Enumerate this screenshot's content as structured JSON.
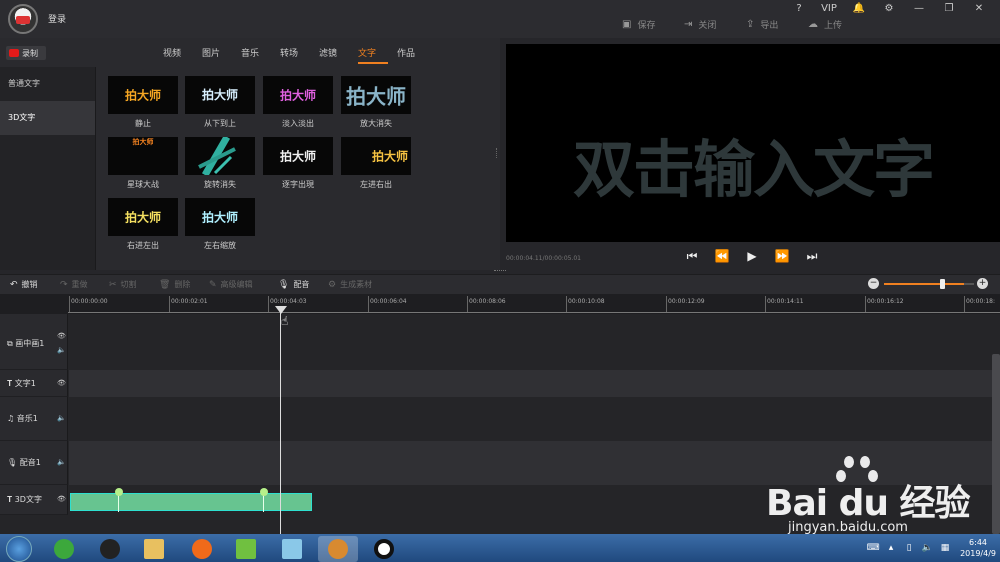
{
  "title_bar": {
    "login": "登录",
    "window_buttons": [
      "?",
      "VIP",
      "🔔",
      "⚙",
      "—",
      "❐",
      "✕"
    ],
    "actions": [
      {
        "label": "保存",
        "icon": "save-icon"
      },
      {
        "label": "关闭",
        "icon": "exit-icon"
      },
      {
        "label": "导出",
        "icon": "export-icon"
      },
      {
        "label": "上传",
        "icon": "upload-icon"
      }
    ]
  },
  "media_panel": {
    "record_label": "录制",
    "tabs": [
      "视频",
      "图片",
      "音乐",
      "转场",
      "滤镜",
      "文字",
      "作品"
    ],
    "active_tab": "文字",
    "sidebar": [
      "普通文字",
      "3D文字"
    ],
    "active_sidebar": "3D文字",
    "thumbnails": [
      {
        "text": "拍大师",
        "caption": "静止",
        "color": "#f5a623"
      },
      {
        "text": "拍大师",
        "caption": "从下到上",
        "color": "#d8f0ff"
      },
      {
        "text": "拍大师",
        "caption": "淡入淡出",
        "color": "#e060e0"
      },
      {
        "text": "拍大师",
        "caption": "放大消失",
        "color": "#8ab4c8"
      },
      {
        "text": "拍大师",
        "caption": "星球大战",
        "color": "#f08020"
      },
      {
        "text": "",
        "caption": "旋转消失",
        "color": "#30b0a0"
      },
      {
        "text": "拍大师",
        "caption": "逐字出現",
        "color": "#f0f0f0"
      },
      {
        "text": "拍大师",
        "caption": "左进右出",
        "color": "#f5c242"
      },
      {
        "text": "拍大师",
        "caption": "右进左出",
        "color": "#f5e060"
      },
      {
        "text": "拍大师",
        "caption": "左右缩放",
        "color": "#b0f0ff"
      }
    ]
  },
  "preview": {
    "text": "双击输入文字",
    "timecode": "00:00:04.11/00:00:05.01",
    "controls": [
      "⏮",
      "⏪",
      "▶",
      "⏩",
      "⏭"
    ]
  },
  "toolbar": {
    "buttons": [
      {
        "label": "撤销",
        "icon": "undo-icon",
        "enabled": true
      },
      {
        "label": "重做",
        "icon": "redo-icon",
        "enabled": false
      },
      {
        "label": "切割",
        "icon": "scissors-icon",
        "enabled": false
      },
      {
        "label": "删除",
        "icon": "trash-icon",
        "enabled": false
      },
      {
        "label": "高级编辑",
        "icon": "pen-icon",
        "enabled": false
      },
      {
        "label": "配音",
        "icon": "microphone-icon",
        "enabled": true
      },
      {
        "label": "生成素材",
        "icon": "gear-icon",
        "enabled": false
      }
    ],
    "zoom": {
      "minus": "−",
      "plus": "+",
      "level": 0.7
    }
  },
  "ruler_ticks": [
    "00:00:00:00",
    "00:00:02:01",
    "00:00:04:03",
    "00:00:06:04",
    "00:00:08:06",
    "00:00:10:08",
    "00:00:12:09",
    "00:00:14:11",
    "00:00:16:12",
    "00:00:18:"
  ],
  "tracks": [
    {
      "label": "画中画1",
      "icon": "pip-icon"
    },
    {
      "label": "文字1",
      "icon": "text-icon"
    },
    {
      "label": "音乐1",
      "icon": "music-icon"
    },
    {
      "label": "配音1",
      "icon": "microphone-icon"
    },
    {
      "label": "3D文字",
      "icon": "text-icon"
    }
  ],
  "watermark": {
    "brand": "Bai du 经验",
    "url": "jingyan.baidu.com"
  },
  "taskbar": {
    "time": "6:44",
    "date": "2019/4/9"
  }
}
